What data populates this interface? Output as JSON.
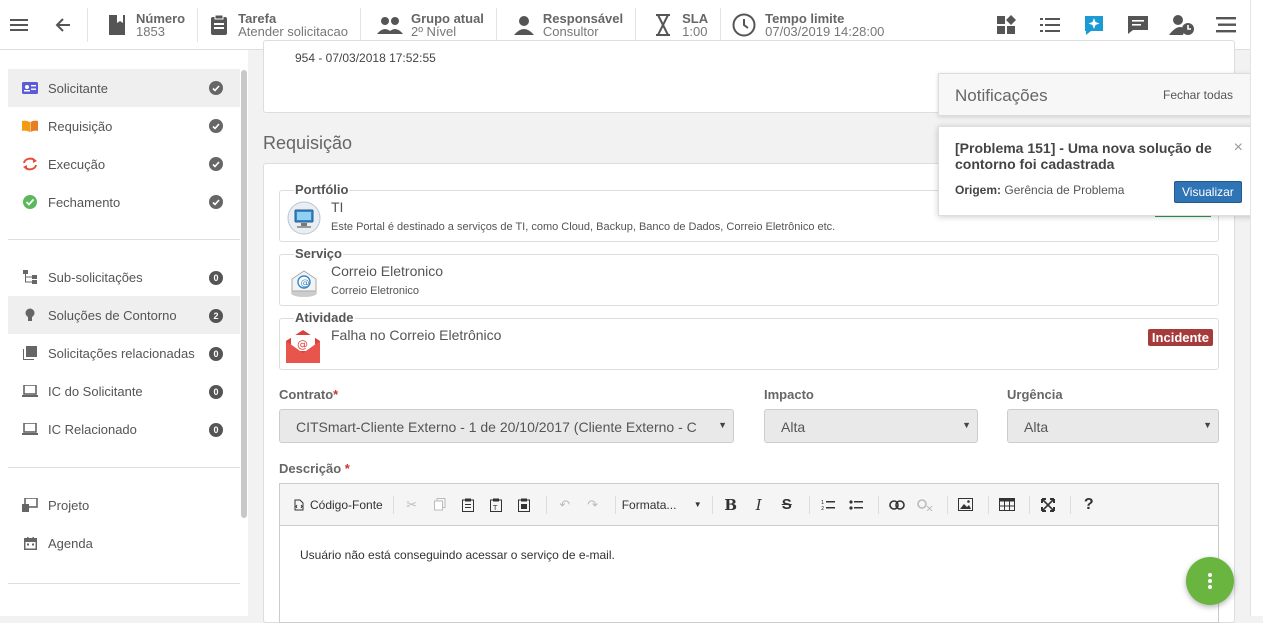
{
  "header": {
    "items": [
      {
        "label": "Número",
        "value": "1853"
      },
      {
        "label": "Tarefa",
        "value": "Atender solicitacao"
      },
      {
        "label": "Grupo atual",
        "value": "2º Nível"
      },
      {
        "label": "Responsável",
        "value": "Consultor"
      },
      {
        "label": "SLA",
        "value": "1:00"
      },
      {
        "label": "Tempo limite",
        "value": "07/03/2019 14:28:00"
      }
    ]
  },
  "sidebar": {
    "steps": [
      {
        "label": "Solicitante",
        "icon": "id-card-icon"
      },
      {
        "label": "Requisição",
        "icon": "book-icon"
      },
      {
        "label": "Execução",
        "icon": "refresh-icon"
      },
      {
        "label": "Fechamento",
        "icon": "check-circle-icon"
      }
    ],
    "links": [
      {
        "label": "Sub-solicitações",
        "count": "0"
      },
      {
        "label": "Soluções de Contorno",
        "count": "2"
      },
      {
        "label": "Solicitações relacionadas",
        "count": "0"
      },
      {
        "label": "IC do Solicitante",
        "count": "0"
      },
      {
        "label": "IC Relacionado",
        "count": "0"
      }
    ],
    "extra": [
      {
        "label": "Projeto"
      },
      {
        "label": "Agenda"
      }
    ]
  },
  "main": {
    "top_card_text": "954 - 07/03/2018 17:52:55",
    "section_title": "Requisição",
    "portfolio": {
      "legend": "Portfólio",
      "name": "TI",
      "desc": "Este Portal é destinado a serviços de TI, como Cloud, Backup, Banco de Dados, Correio Eletrônico etc."
    },
    "servico": {
      "legend": "Serviço",
      "name": "Correio Eletronico",
      "desc": "Correio Eletronico"
    },
    "atividade": {
      "legend": "Atividade",
      "name": "Falha no Correio Eletrônico",
      "badge": "Incidente"
    },
    "contrato": {
      "label": "Contrato",
      "value": "CITSmart-Cliente Externo - 1 de 20/10/2017 (Cliente Externo - C"
    },
    "impacto": {
      "label": "Impacto",
      "value": "Alta"
    },
    "urgencia": {
      "label": "Urgência",
      "value": "Alta"
    },
    "descricao": {
      "label": "Descrição",
      "source_label": "Código-Fonte",
      "format_label": "Formata...",
      "text": "Usuário não está conseguindo acessar o serviço de e-mail."
    }
  },
  "notifications": {
    "title": "Notificações",
    "close_all": "Fechar todas",
    "item": {
      "title": "[Problema 151] - Uma nova solução de contorno foi cadastrada",
      "origin_label": "Origem:",
      "origin_value": "Gerência de Problema",
      "button": "Visualizar"
    }
  },
  "colors": {
    "accent": "#1b9ad4",
    "badge": "#a63b3b",
    "button": "#2f74b5",
    "fab": "#6ab440"
  }
}
